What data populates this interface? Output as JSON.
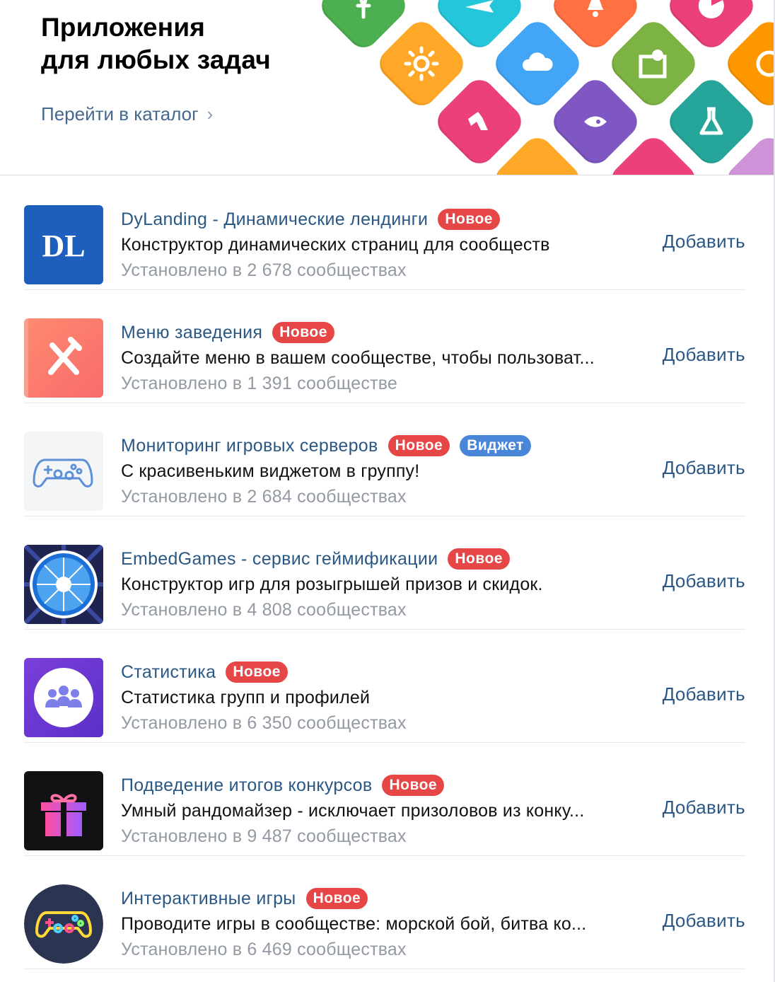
{
  "header": {
    "title_line1": "Приложения",
    "title_line2": "для любых задач",
    "catalog_link": "Перейти в каталог",
    "catalog_chevron": "›",
    "decor_tiles": [
      {
        "color": "#4caf50",
        "icon": "flower-icon"
      },
      {
        "color": "#26c6da",
        "icon": "airplane-icon"
      },
      {
        "color": "#ff7043",
        "icon": "bell-icon"
      },
      {
        "color": "#ec407a",
        "icon": "pacman-icon"
      },
      {
        "color": "#ffa726",
        "icon": "sun-icon"
      },
      {
        "color": "#42a5f5",
        "icon": "cloud-icon"
      },
      {
        "color": "#7cb342",
        "icon": "map-pin-icon"
      },
      {
        "color": "#ff9800",
        "icon": "clock-icon"
      },
      {
        "color": "#ec407a",
        "icon": "boot-icon"
      },
      {
        "color": "#7e57c2",
        "icon": "rocket-icon"
      },
      {
        "color": "#26a69a",
        "icon": "flask-icon"
      }
    ]
  },
  "apps": [
    {
      "name": "DyLanding - Динамические лендинги",
      "badges": [
        "Новое"
      ],
      "description": "Конструктор динамических страниц для сообществ",
      "installs": "Установлено в 2 678 сообществах",
      "action": "Добавить",
      "icon": "dylanding-logo",
      "icon_text": "DL"
    },
    {
      "name": "Меню заведения",
      "badges": [
        "Новое"
      ],
      "description": "Создайте меню в вашем сообществе, чтобы пользоват...",
      "installs": "Установлено в 1 391 сообществе",
      "action": "Добавить",
      "icon": "fork-knife-icon"
    },
    {
      "name": "Мониторинг игровых серверов",
      "badges": [
        "Новое",
        "Виджет"
      ],
      "description": "С красивеньким виджетом в группу!",
      "installs": "Установлено в 2 684 сообществах",
      "action": "Добавить",
      "icon": "gamepad-outline-icon"
    },
    {
      "name": "EmbedGames - сервис геймификации",
      "badges": [
        "Новое"
      ],
      "description": "Конструктор игр для розыгрышей призов и скидок.",
      "installs": "Установлено в 4 808 сообществах",
      "action": "Добавить",
      "icon": "prize-wheel-icon"
    },
    {
      "name": "Статистика",
      "badges": [
        "Новое"
      ],
      "description": "Статистика групп и профилей",
      "installs": "Установлено в 6 350 сообществах",
      "action": "Добавить",
      "icon": "people-group-icon"
    },
    {
      "name": "Подведение итогов конкурсов",
      "badges": [
        "Новое"
      ],
      "description": "Умный рандомайзер - исключает призоловов из конку...",
      "installs": "Установлено в 9 487 сообществах",
      "action": "Добавить",
      "icon": "gift-icon"
    },
    {
      "name": "Интерактивные игры",
      "badges": [
        "Новое"
      ],
      "description": "Проводите игры в сообществе: морской бой, битва ко...",
      "installs": "Установлено в 6 469 сообществах",
      "action": "Добавить",
      "icon": "gamepad-neon-icon"
    }
  ],
  "colors": {
    "link": "#2a5885",
    "badge_new": "#e64646",
    "badge_widget": "#4a86d8",
    "muted_text": "#939aa3"
  }
}
